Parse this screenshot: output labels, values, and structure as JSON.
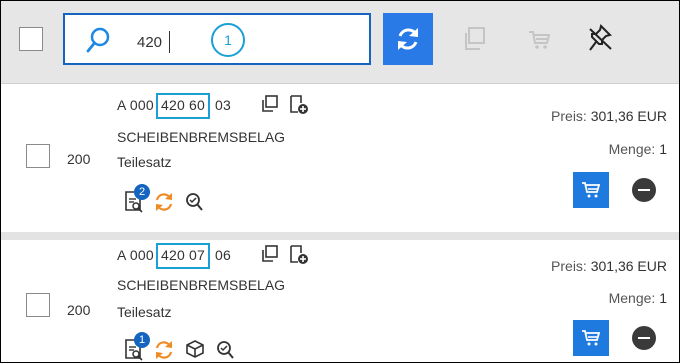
{
  "search": {
    "value": "420",
    "callout": "1"
  },
  "toolbar": {
    "icons": [
      "refresh-icon",
      "copy-icon",
      "cart-icon",
      "unpin-icon"
    ],
    "colors": {
      "primary": "#2979e6",
      "highlight": "#1aa0d6",
      "disabled": "#c5c5c5"
    }
  },
  "items": [
    {
      "quantity": "200",
      "part_prefix": "A 000",
      "part_mid": "420 60",
      "part_suffix": "03",
      "name": "SCHEIBENBREMSBELAG",
      "subtitle": "Teilesatz",
      "price_label": "Preis:",
      "price_value": "301,36 EUR",
      "menge_label": "Menge:",
      "menge_value": "1",
      "badge": "2"
    },
    {
      "quantity": "200",
      "part_prefix": "A 000",
      "part_mid": "420 07",
      "part_suffix": "06",
      "name": "SCHEIBENBREMSBELAG",
      "subtitle": "Teilesatz",
      "price_label": "Preis:",
      "price_value": "301,36 EUR",
      "menge_label": "Menge:",
      "menge_value": "1",
      "badge": "1"
    }
  ]
}
